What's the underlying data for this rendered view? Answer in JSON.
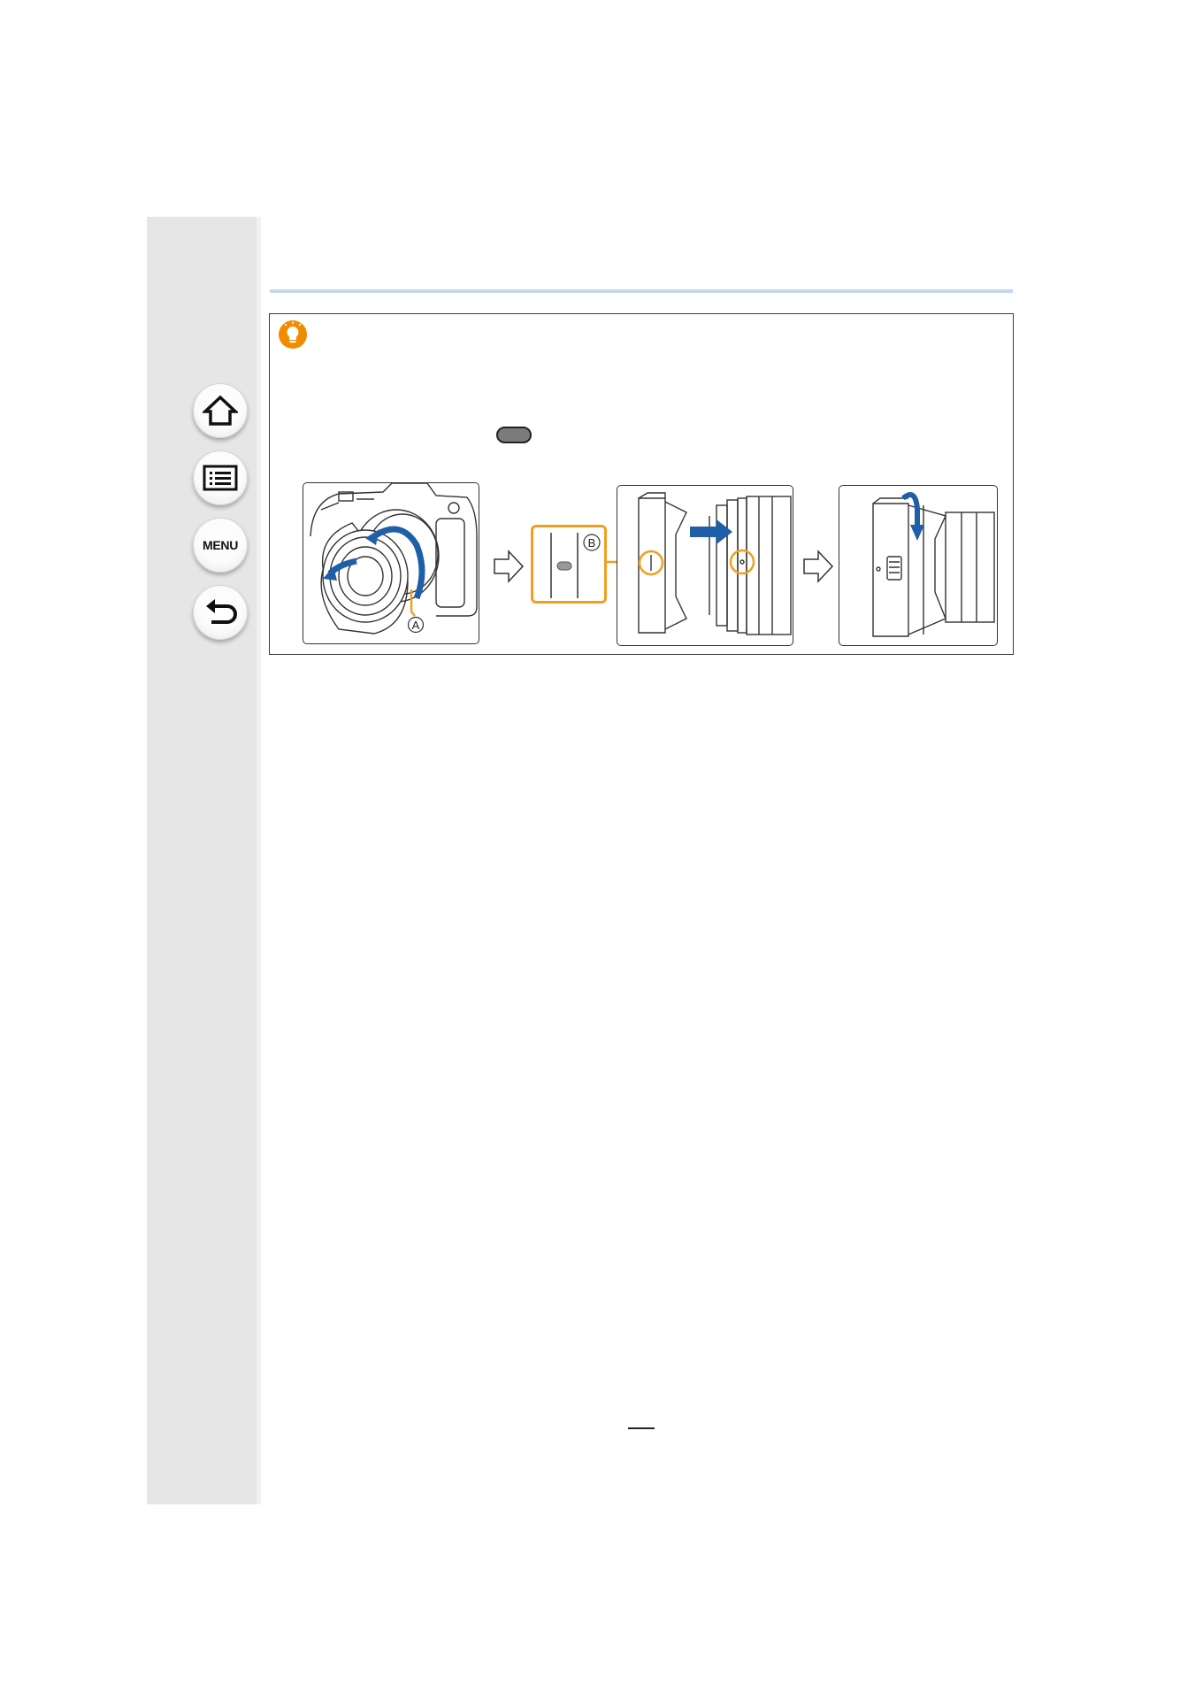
{
  "nav": {
    "home": {
      "icon": "home-icon"
    },
    "contents": {
      "icon": "list-icon"
    },
    "menu": {
      "label": "MENU"
    },
    "back": {
      "icon": "back-arrow-icon"
    }
  },
  "tip": {
    "icon": "lightbulb-icon",
    "title": "",
    "line1": "",
    "line2": "",
    "button_glyph": "gray-oval-button"
  },
  "illustrations": {
    "label_a": "A",
    "label_b": "B",
    "colors": {
      "accent_blue": "#1f5fa8",
      "callout_orange": "#f0a020",
      "outline": "#333333"
    }
  },
  "footer": {
    "page_number": ""
  }
}
